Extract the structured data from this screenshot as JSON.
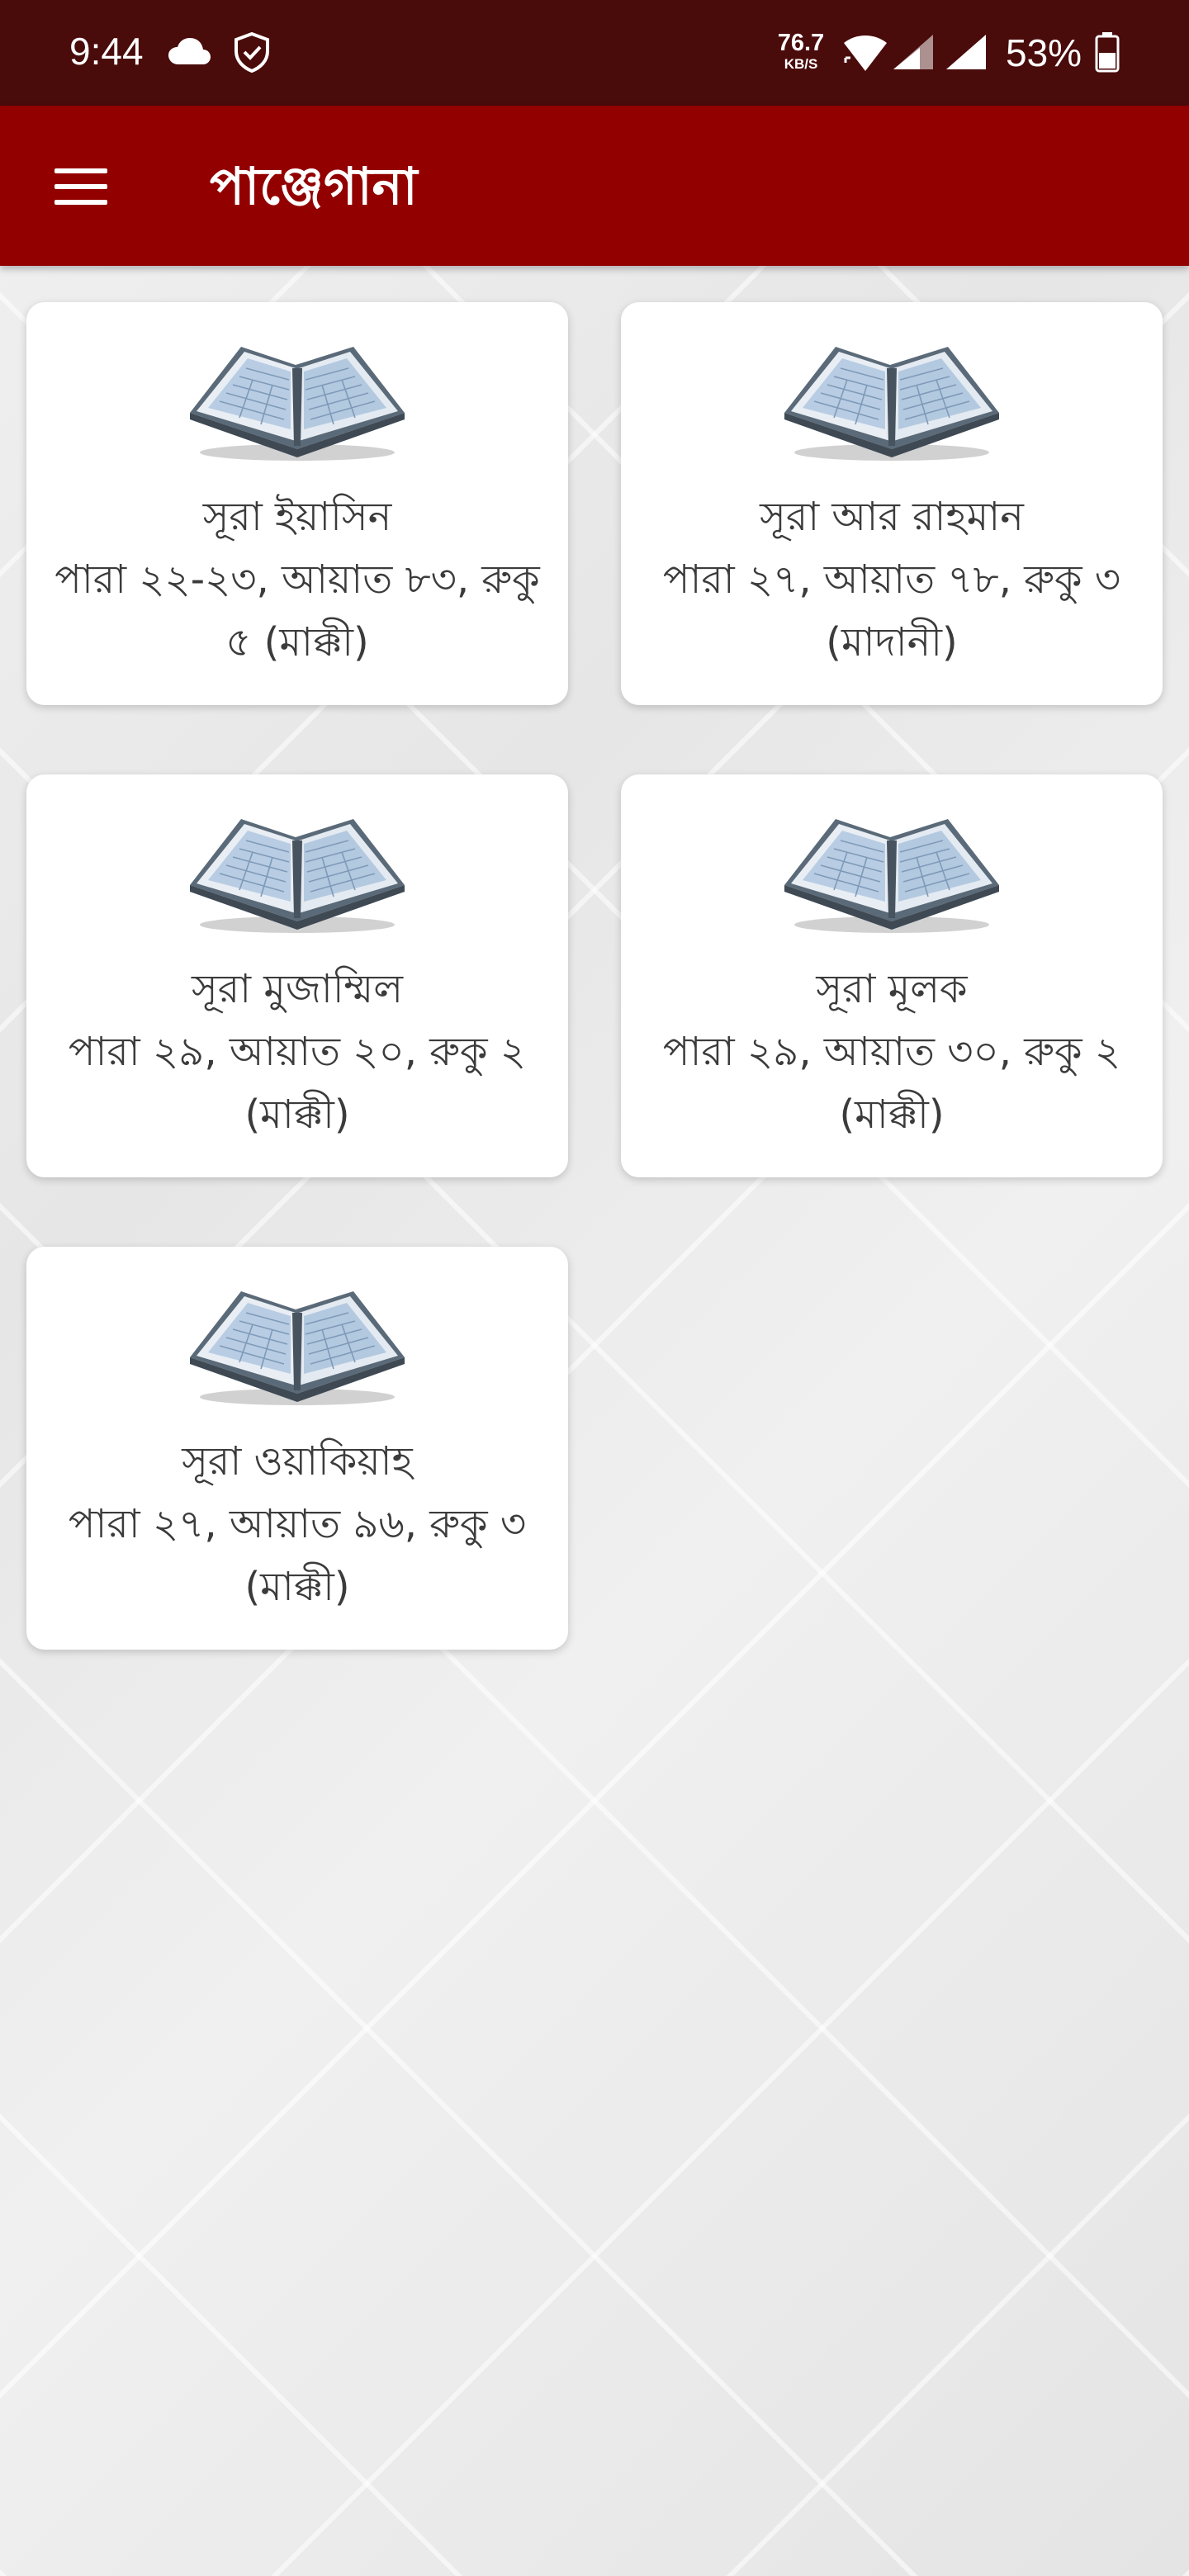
{
  "status_bar": {
    "time": "9:44",
    "net_speed_value": "76.7",
    "net_speed_unit": "KB/S",
    "battery_percent": "53%",
    "icons": [
      "cloud-icon",
      "shield-icon",
      "wifi-icon",
      "signal-icon",
      "signal-icon",
      "battery-icon"
    ]
  },
  "app_bar": {
    "title": "পাঞ্জেগানা",
    "menu_icon": "hamburger-menu-icon"
  },
  "colors": {
    "status_bar": "#4a0b0b",
    "app_bar": "#930000",
    "card_text": "#3b3b3b",
    "card_background": "#ffffff"
  },
  "surahs": [
    {
      "title": "সূরা ইয়াসিন",
      "info": "পারা ২২-২৩, আয়াত ৮৩, রুকু ৫ (মাক্কী)",
      "icon": "open-quran-icon"
    },
    {
      "title": "সূরা আর রাহমান",
      "info": "পারা ২৭, আয়াত ৭৮, রুকু ৩ (মাদানী)",
      "icon": "open-quran-icon"
    },
    {
      "title": "সূরা মুজাম্মিল",
      "info": "পারা ২৯, আয়াত ২০, রুকু ২ (মাক্কী)",
      "icon": "open-quran-icon"
    },
    {
      "title": "সূরা মূলক",
      "info": "পারা ২৯, আয়াত ৩০, রুকু ২ (মাক্কী)",
      "icon": "open-quran-icon"
    },
    {
      "title": "সূরা ওয়াকিয়াহ",
      "info": "পারা ২৭, আয়াত ৯৬, রুকু ৩ (মাক্কী)",
      "icon": "open-quran-icon"
    }
  ]
}
